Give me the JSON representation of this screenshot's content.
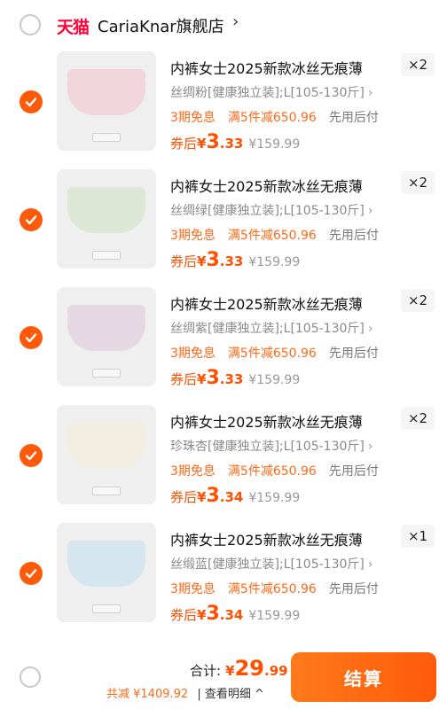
{
  "store": {
    "brand_logo": "天猫",
    "name": "CariaKnar旗舰店",
    "chevron": "›"
  },
  "items": [
    {
      "title": "内裤女士2025新款冰丝无痕薄",
      "qty": "×2",
      "spec": "丝绸粉[健康独立装];L[105-130斤]",
      "promo_installment": "3期免息",
      "promo_discount": "满5件减650.96",
      "promo_paylater": "先用后付",
      "after_label": "券后",
      "currency": "¥",
      "price_int": "3",
      "price_dec": ".33",
      "orig_price": "¥159.99",
      "color": "#f0d6dc"
    },
    {
      "title": "内裤女士2025新款冰丝无痕薄",
      "qty": "×2",
      "spec": "丝绸绿[健康独立装];L[105-130斤]",
      "promo_installment": "3期免息",
      "promo_discount": "满5件减650.96",
      "promo_paylater": "先用后付",
      "after_label": "券后",
      "currency": "¥",
      "price_int": "3",
      "price_dec": ".33",
      "orig_price": "¥159.99",
      "color": "#dce8d4"
    },
    {
      "title": "内裤女士2025新款冰丝无痕薄",
      "qty": "×2",
      "spec": "丝绸紫[健康独立装];L[105-130斤]",
      "promo_installment": "3期免息",
      "promo_discount": "满5件减650.96",
      "promo_paylater": "先用后付",
      "after_label": "券后",
      "currency": "¥",
      "price_int": "3",
      "price_dec": ".33",
      "orig_price": "¥159.99",
      "color": "#e6d8e2"
    },
    {
      "title": "内裤女士2025新款冰丝无痕薄",
      "qty": "×2",
      "spec": "珍珠杏[健康独立装];L[105-130斤]",
      "promo_installment": "3期免息",
      "promo_discount": "满5件减650.96",
      "promo_paylater": "先用后付",
      "after_label": "券后",
      "currency": "¥",
      "price_int": "3",
      "price_dec": ".34",
      "orig_price": "¥159.99",
      "color": "#f2efe2"
    },
    {
      "title": "内裤女士2025新款冰丝无痕薄",
      "qty": "×1",
      "spec": "丝缎蓝[健康独立装];L[105-130斤]",
      "promo_installment": "3期免息",
      "promo_discount": "满5件减650.96",
      "promo_paylater": "先用后付",
      "after_label": "券后",
      "currency": "¥",
      "price_int": "3",
      "price_dec": ".34",
      "orig_price": "¥159.99",
      "color": "#d6e6ee"
    }
  ],
  "footer": {
    "total_label": "合计:",
    "currency": "¥",
    "total_int": "29",
    "total_dec": ".99",
    "saving": "共减 ¥1409.92",
    "detail": "| 查看明细 ^",
    "checkout": "结算"
  },
  "colors": {
    "accent": "#ff5a0a",
    "price": "#ff5000",
    "promo": "#ff6a1a",
    "tmall": "#ff0036"
  }
}
